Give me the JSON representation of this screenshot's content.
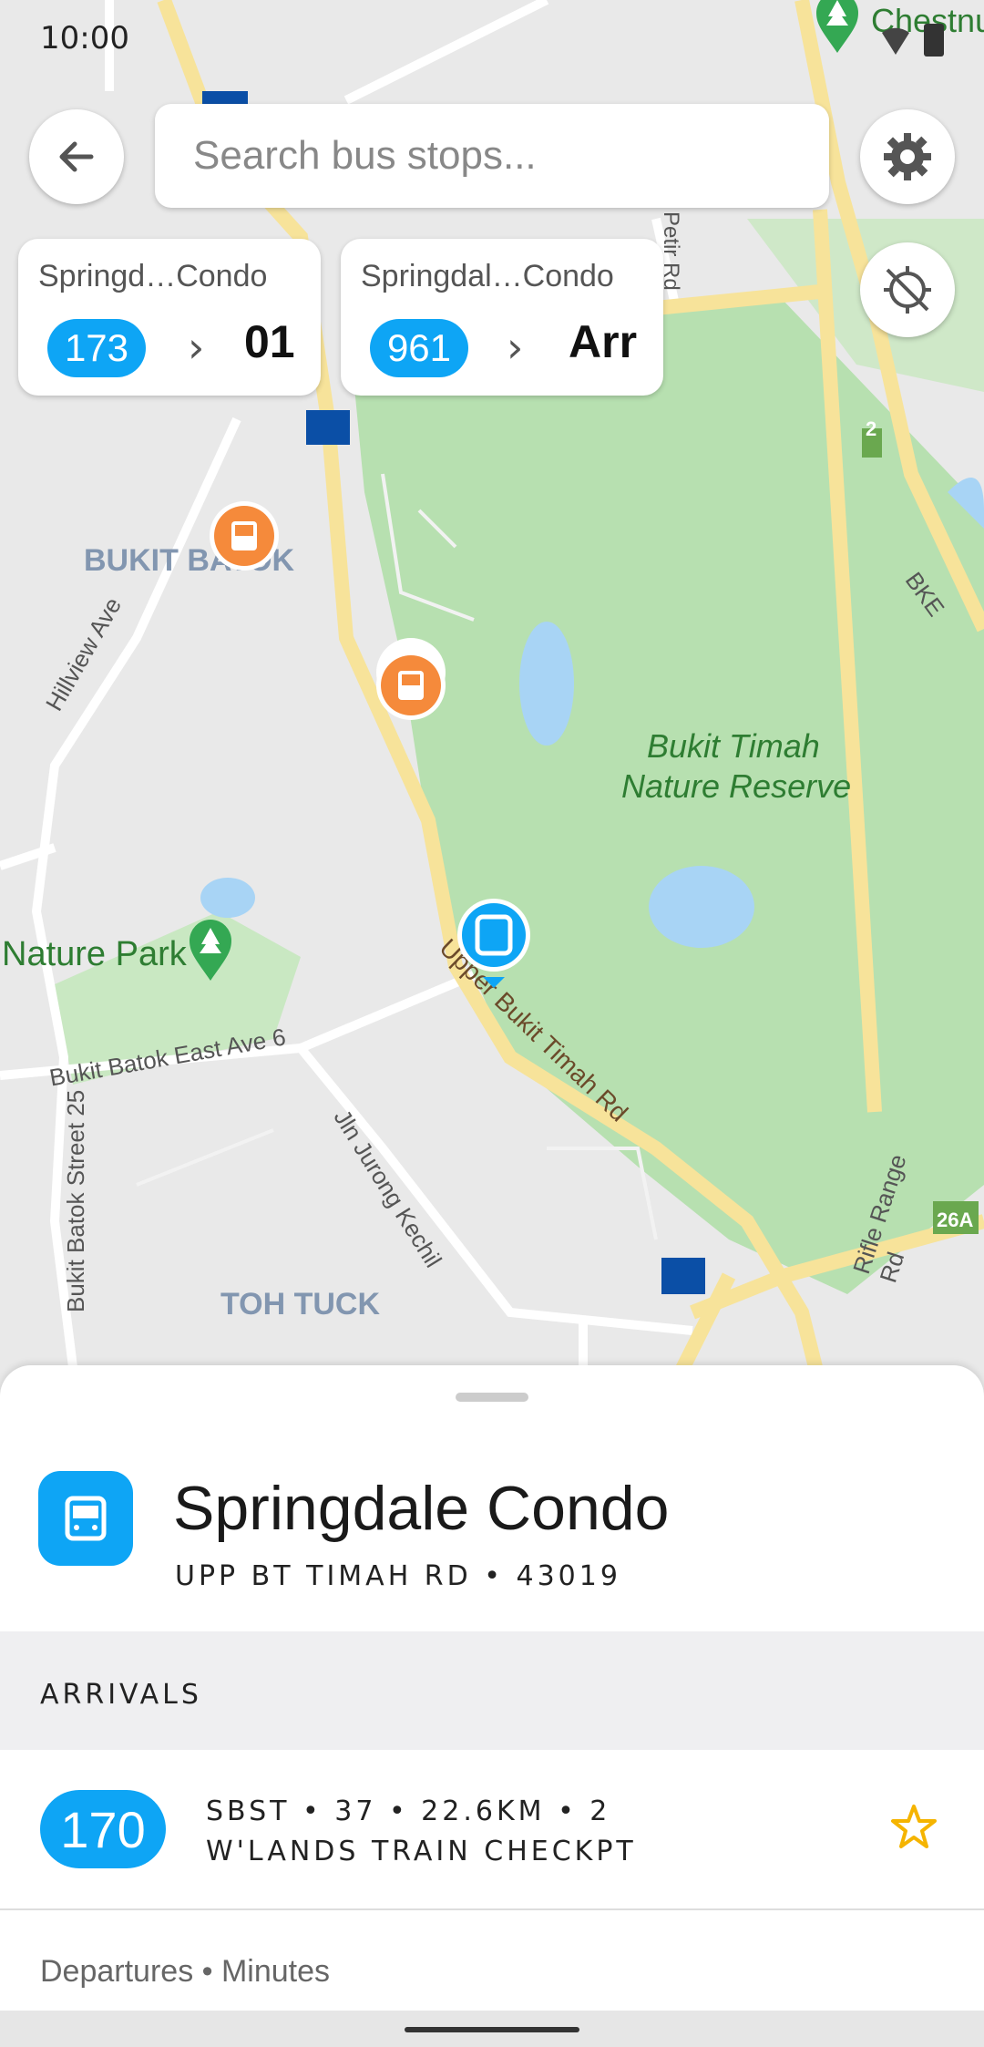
{
  "status_bar": {
    "time": "10:00"
  },
  "search": {
    "placeholder": "Search bus stops..."
  },
  "pinned": [
    {
      "title": "Springd…Condo",
      "service": "173",
      "value": "01"
    },
    {
      "title": "Springdal…Condo",
      "service": "961",
      "value": "Arr"
    }
  ],
  "map_labels": {
    "bukit_batok": "BUKIT BATOK",
    "hillview": "Hillview Ave",
    "reserve_line1": "Bukit Timah",
    "reserve_line2": "Nature Reserve",
    "nature_park": "Nature Park",
    "bukit_batok_east": "Bukit Batok East Ave 6",
    "upper_bt": "Upper Bukit Timah Rd",
    "jln_jurong": "Jln Jurong Kechil",
    "bb_street25": "Bukit Batok Street 25",
    "toh_tuck": "TOH TUCK",
    "rifle_range": "Rifle Range Rd",
    "bke": "BKE",
    "petir": "Petir Rd",
    "chestnut": "Chestnu",
    "exit_2": "2",
    "exit_26a": "26A"
  },
  "stop": {
    "name": "Springdale Condo",
    "subtitle": "UPP BT TIMAH RD • 43019"
  },
  "arrivals": {
    "header": "ARRIVALS",
    "services": [
      {
        "number": "170",
        "line1": "SBST  •  37  •  22.6KM  •  2",
        "line2": "W'LANDS TRAIN CHECKPT"
      }
    ],
    "departures_label": "Departures  •  Minutes"
  },
  "colors": {
    "accent": "#0ea5f5",
    "park": "#b7e0b0",
    "water": "#a8d4f5",
    "road": "#f7e39a",
    "bus_orange": "#f58a3b"
  }
}
